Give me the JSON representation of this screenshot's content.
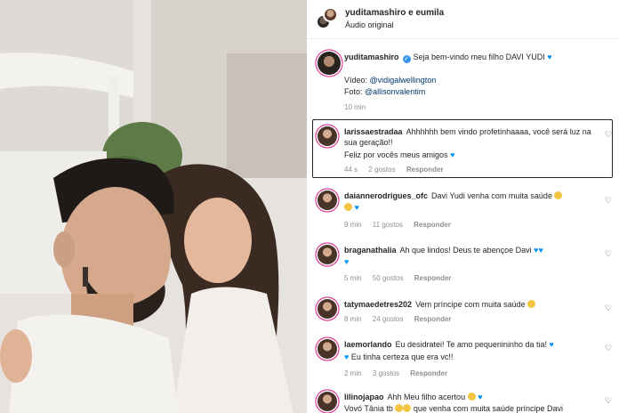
{
  "header": {
    "title": "yuditamashiro e eumila",
    "subtitle": "Áudio original"
  },
  "caption": {
    "username": "yuditamashiro",
    "text": "Seja bem-vindo meu filho DAVI YUDI",
    "credit_video_prefix": "Vídeo:",
    "credit_video_link": "@vidigalwellington",
    "credit_photo_prefix": "Foto:",
    "credit_photo_link": "@allisonvalentim",
    "time": "10 min"
  },
  "comments": [
    {
      "username": "larissaestradaa",
      "text": "Ahhhhhh bem vindo profetinhaaaa, você será luz na sua geração!!",
      "text2": "Feliz por vocês meus amigos",
      "time": "44 s",
      "likes": "2 gostos",
      "reply": "Responder"
    },
    {
      "username": "daiannerodrigues_ofc",
      "text": "Davi Yudi venha com muita saúde",
      "time": "9 min",
      "likes": "11 gostos",
      "reply": "Responder"
    },
    {
      "username": "braganathalia",
      "text": "Ah que lindos! Deus te abençoe Davi",
      "time": "5 min",
      "likes": "50 gostos",
      "reply": "Responder"
    },
    {
      "username": "tatymaedetres202",
      "text": "Vem príncipe com muita saúde",
      "time": "8 min",
      "likes": "24 gostos",
      "reply": "Responder"
    },
    {
      "username": "laemorlando",
      "text": "Eu desidratei! Te amo pequenininho da tia!",
      "text2": "Eu tinha certeza que era vc!!",
      "time": "2 min",
      "likes": "3 gostos",
      "reply": "Responder"
    },
    {
      "username": "lilinojapao",
      "text": "Ahh Meu filho acertou",
      "text2": "Vovó Tânia tb",
      "text3": "que venha com muita saúde príncipe Davi"
    }
  ],
  "colors": {
    "story_ring": "#d92e8a",
    "verified": "#3897f0",
    "link": "#00376b",
    "meta_gray": "#8e8e8e"
  },
  "icons": {
    "heart": "♡"
  }
}
